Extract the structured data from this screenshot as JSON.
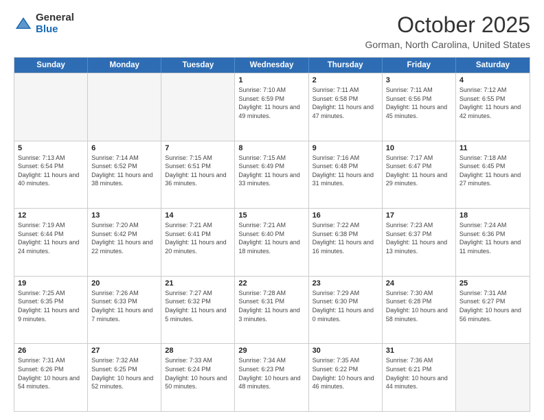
{
  "logo": {
    "general": "General",
    "blue": "Blue"
  },
  "header": {
    "month": "October 2025",
    "location": "Gorman, North Carolina, United States"
  },
  "days": [
    "Sunday",
    "Monday",
    "Tuesday",
    "Wednesday",
    "Thursday",
    "Friday",
    "Saturday"
  ],
  "weeks": [
    [
      {
        "day": "",
        "info": ""
      },
      {
        "day": "",
        "info": ""
      },
      {
        "day": "",
        "info": ""
      },
      {
        "day": "1",
        "info": "Sunrise: 7:10 AM\nSunset: 6:59 PM\nDaylight: 11 hours and 49 minutes."
      },
      {
        "day": "2",
        "info": "Sunrise: 7:11 AM\nSunset: 6:58 PM\nDaylight: 11 hours and 47 minutes."
      },
      {
        "day": "3",
        "info": "Sunrise: 7:11 AM\nSunset: 6:56 PM\nDaylight: 11 hours and 45 minutes."
      },
      {
        "day": "4",
        "info": "Sunrise: 7:12 AM\nSunset: 6:55 PM\nDaylight: 11 hours and 42 minutes."
      }
    ],
    [
      {
        "day": "5",
        "info": "Sunrise: 7:13 AM\nSunset: 6:54 PM\nDaylight: 11 hours and 40 minutes."
      },
      {
        "day": "6",
        "info": "Sunrise: 7:14 AM\nSunset: 6:52 PM\nDaylight: 11 hours and 38 minutes."
      },
      {
        "day": "7",
        "info": "Sunrise: 7:15 AM\nSunset: 6:51 PM\nDaylight: 11 hours and 36 minutes."
      },
      {
        "day": "8",
        "info": "Sunrise: 7:15 AM\nSunset: 6:49 PM\nDaylight: 11 hours and 33 minutes."
      },
      {
        "day": "9",
        "info": "Sunrise: 7:16 AM\nSunset: 6:48 PM\nDaylight: 11 hours and 31 minutes."
      },
      {
        "day": "10",
        "info": "Sunrise: 7:17 AM\nSunset: 6:47 PM\nDaylight: 11 hours and 29 minutes."
      },
      {
        "day": "11",
        "info": "Sunrise: 7:18 AM\nSunset: 6:45 PM\nDaylight: 11 hours and 27 minutes."
      }
    ],
    [
      {
        "day": "12",
        "info": "Sunrise: 7:19 AM\nSunset: 6:44 PM\nDaylight: 11 hours and 24 minutes."
      },
      {
        "day": "13",
        "info": "Sunrise: 7:20 AM\nSunset: 6:42 PM\nDaylight: 11 hours and 22 minutes."
      },
      {
        "day": "14",
        "info": "Sunrise: 7:21 AM\nSunset: 6:41 PM\nDaylight: 11 hours and 20 minutes."
      },
      {
        "day": "15",
        "info": "Sunrise: 7:21 AM\nSunset: 6:40 PM\nDaylight: 11 hours and 18 minutes."
      },
      {
        "day": "16",
        "info": "Sunrise: 7:22 AM\nSunset: 6:38 PM\nDaylight: 11 hours and 16 minutes."
      },
      {
        "day": "17",
        "info": "Sunrise: 7:23 AM\nSunset: 6:37 PM\nDaylight: 11 hours and 13 minutes."
      },
      {
        "day": "18",
        "info": "Sunrise: 7:24 AM\nSunset: 6:36 PM\nDaylight: 11 hours and 11 minutes."
      }
    ],
    [
      {
        "day": "19",
        "info": "Sunrise: 7:25 AM\nSunset: 6:35 PM\nDaylight: 11 hours and 9 minutes."
      },
      {
        "day": "20",
        "info": "Sunrise: 7:26 AM\nSunset: 6:33 PM\nDaylight: 11 hours and 7 minutes."
      },
      {
        "day": "21",
        "info": "Sunrise: 7:27 AM\nSunset: 6:32 PM\nDaylight: 11 hours and 5 minutes."
      },
      {
        "day": "22",
        "info": "Sunrise: 7:28 AM\nSunset: 6:31 PM\nDaylight: 11 hours and 3 minutes."
      },
      {
        "day": "23",
        "info": "Sunrise: 7:29 AM\nSunset: 6:30 PM\nDaylight: 11 hours and 0 minutes."
      },
      {
        "day": "24",
        "info": "Sunrise: 7:30 AM\nSunset: 6:28 PM\nDaylight: 10 hours and 58 minutes."
      },
      {
        "day": "25",
        "info": "Sunrise: 7:31 AM\nSunset: 6:27 PM\nDaylight: 10 hours and 56 minutes."
      }
    ],
    [
      {
        "day": "26",
        "info": "Sunrise: 7:31 AM\nSunset: 6:26 PM\nDaylight: 10 hours and 54 minutes."
      },
      {
        "day": "27",
        "info": "Sunrise: 7:32 AM\nSunset: 6:25 PM\nDaylight: 10 hours and 52 minutes."
      },
      {
        "day": "28",
        "info": "Sunrise: 7:33 AM\nSunset: 6:24 PM\nDaylight: 10 hours and 50 minutes."
      },
      {
        "day": "29",
        "info": "Sunrise: 7:34 AM\nSunset: 6:23 PM\nDaylight: 10 hours and 48 minutes."
      },
      {
        "day": "30",
        "info": "Sunrise: 7:35 AM\nSunset: 6:22 PM\nDaylight: 10 hours and 46 minutes."
      },
      {
        "day": "31",
        "info": "Sunrise: 7:36 AM\nSunset: 6:21 PM\nDaylight: 10 hours and 44 minutes."
      },
      {
        "day": "",
        "info": ""
      }
    ]
  ]
}
